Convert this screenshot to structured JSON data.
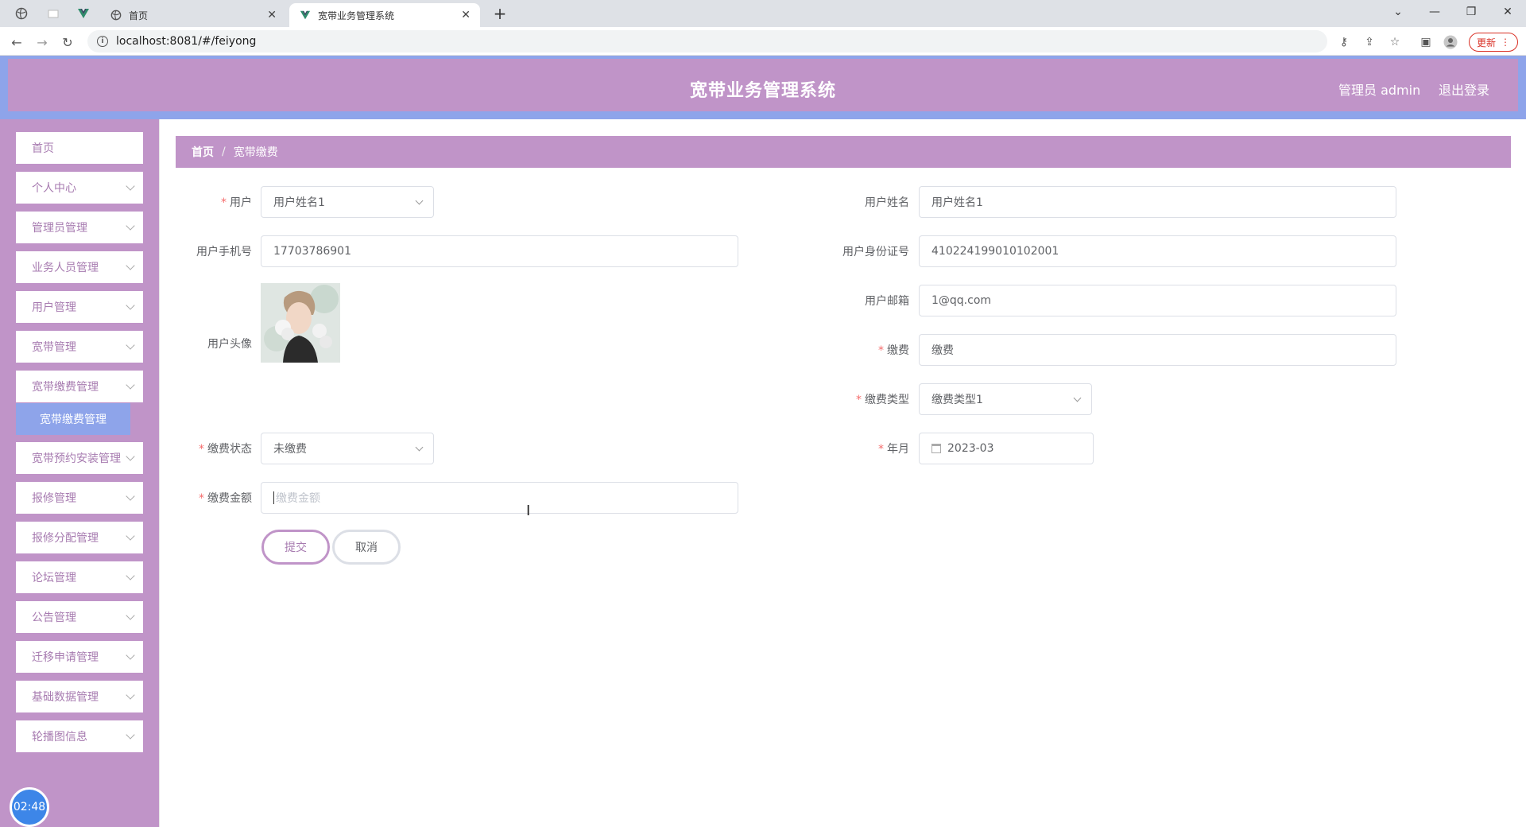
{
  "browser": {
    "tabs": [
      {
        "title": "首页"
      },
      {
        "title": "宽带业务管理系统"
      }
    ],
    "url": "localhost:8081/#/feiyong",
    "update_label": "更新"
  },
  "header": {
    "title": "宽带业务管理系统",
    "user": "管理员 admin",
    "logout": "退出登录"
  },
  "sidebar": {
    "items": [
      {
        "label": "首页"
      },
      {
        "label": "个人中心"
      },
      {
        "label": "管理员管理"
      },
      {
        "label": "业务人员管理"
      },
      {
        "label": "用户管理"
      },
      {
        "label": "宽带管理"
      },
      {
        "label": "宽带缴费管理"
      },
      {
        "label": "宽带预约安装管理"
      },
      {
        "label": "报修管理"
      },
      {
        "label": "报修分配管理"
      },
      {
        "label": "论坛管理"
      },
      {
        "label": "公告管理"
      },
      {
        "label": "迁移申请管理"
      },
      {
        "label": "基础数据管理"
      },
      {
        "label": "轮播图信息"
      }
    ],
    "active_sub": "宽带缴费管理",
    "clock": "02:48"
  },
  "breadcrumb": {
    "home": "首页",
    "sep": "/",
    "current": "宽带缴费"
  },
  "form": {
    "user_label": "用户",
    "user_value": "用户姓名1",
    "user_name_label": "用户姓名",
    "user_name_value": "用户姓名1",
    "phone_label": "用户手机号",
    "phone_value": "17703786901",
    "idcard_label": "用户身份证号",
    "idcard_value": "410224199010102001",
    "avatar_label": "用户头像",
    "email_label": "用户邮箱",
    "email_value": "1@qq.com",
    "fee_label": "缴费",
    "fee_value": "缴费",
    "fee_type_label": "缴费类型",
    "fee_type_value": "缴费类型1",
    "status_label": "缴费状态",
    "status_value": "未缴费",
    "month_label": "年月",
    "month_value": "2023-03",
    "amount_label": "缴费金额",
    "amount_placeholder": "缴费金额",
    "submit": "提交",
    "cancel": "取消"
  },
  "colors": {
    "theme_purple": "#c094c8",
    "theme_blue": "#8ea4ea",
    "required": "#f56c6c"
  }
}
